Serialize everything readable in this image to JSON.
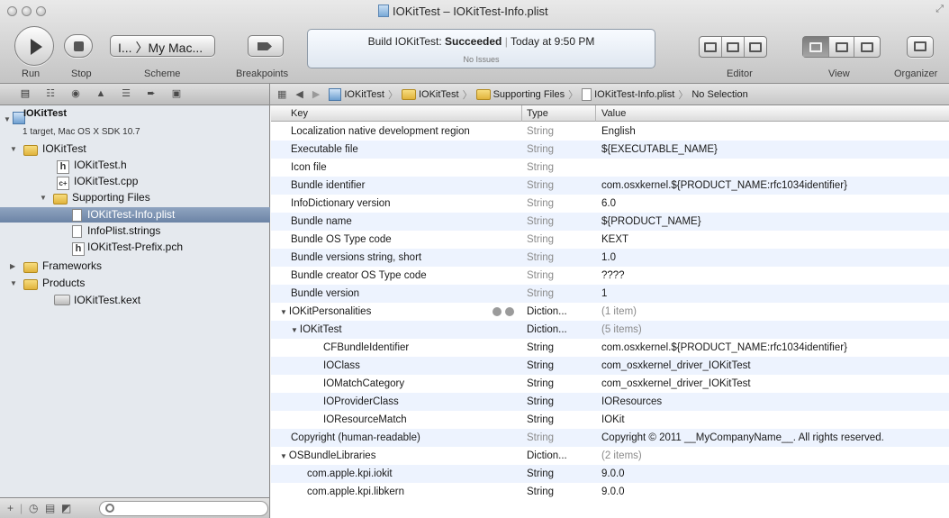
{
  "window": {
    "title": "IOKitTest – IOKitTest-Info.plist"
  },
  "toolbar": {
    "run_label": "Run",
    "stop_label": "Stop",
    "scheme_text": "I... 〉My Mac...",
    "scheme_label": "Scheme",
    "breakpoints_label": "Breakpoints",
    "activity_title": "Build IOKitTest: Succeeded",
    "activity_bold": "Succeeded",
    "activity_prefix": "Build IOKitTest:",
    "activity_time": "Today at 9:50 PM",
    "activity_issues": "No Issues",
    "editor_label": "Editor",
    "view_label": "View",
    "organizer_label": "Organizer"
  },
  "jump_bar": {
    "items": [
      "IOKitTest",
      "IOKitTest",
      "Supporting Files",
      "IOKitTest-Info.plist",
      "No Selection"
    ]
  },
  "sidebar": {
    "project_name": "IOKitTest",
    "project_sub": "1 target, Mac OS X SDK 10.7",
    "items": [
      {
        "label": "IOKitTest",
        "kind": "folder"
      },
      {
        "label": "IOKitTest.h",
        "kind": "h-file"
      },
      {
        "label": "IOKitTest.cpp",
        "kind": "cpp-file"
      },
      {
        "label": "Supporting Files",
        "kind": "folder"
      },
      {
        "label": "IOKitTest-Info.plist",
        "kind": "plist-file"
      },
      {
        "label": "InfoPlist.strings",
        "kind": "strings-file"
      },
      {
        "label": "IOKitTest-Prefix.pch",
        "kind": "h-file"
      },
      {
        "label": "Frameworks",
        "kind": "folder"
      },
      {
        "label": "Products",
        "kind": "folder"
      },
      {
        "label": "IOKitTest.kext",
        "kind": "kext"
      }
    ]
  },
  "plist": {
    "headers": {
      "key": "Key",
      "type": "Type",
      "value": "Value"
    },
    "rows": [
      {
        "key": "Localization native development region",
        "type": "String",
        "value": "English"
      },
      {
        "key": "Executable file",
        "type": "String",
        "value": "${EXECUTABLE_NAME}"
      },
      {
        "key": "Icon file",
        "type": "String",
        "value": ""
      },
      {
        "key": "Bundle identifier",
        "type": "String",
        "value": "com.osxkernel.${PRODUCT_NAME:rfc1034identifier}"
      },
      {
        "key": "InfoDictionary version",
        "type": "String",
        "value": "6.0"
      },
      {
        "key": "Bundle name",
        "type": "String",
        "value": "${PRODUCT_NAME}"
      },
      {
        "key": "Bundle OS Type code",
        "type": "String",
        "value": "KEXT"
      },
      {
        "key": "Bundle versions string, short",
        "type": "String",
        "value": "1.0"
      },
      {
        "key": "Bundle creator OS Type code",
        "type": "String",
        "value": "????"
      },
      {
        "key": "Bundle version",
        "type": "String",
        "value": "1"
      },
      {
        "key": "IOKitPersonalities",
        "type": "Diction...",
        "value": "(1 item)"
      },
      {
        "key": "IOKitTest",
        "type": "Diction...",
        "value": "(5 items)"
      },
      {
        "key": "CFBundleIdentifier",
        "type": "String",
        "value": "com.osxkernel.${PRODUCT_NAME:rfc1034identifier}"
      },
      {
        "key": "IOClass",
        "type": "String",
        "value": "com_osxkernel_driver_IOKitTest"
      },
      {
        "key": "IOMatchCategory",
        "type": "String",
        "value": "com_osxkernel_driver_IOKitTest"
      },
      {
        "key": "IOProviderClass",
        "type": "String",
        "value": "IOResources"
      },
      {
        "key": "IOResourceMatch",
        "type": "String",
        "value": "IOKit"
      },
      {
        "key": "Copyright (human-readable)",
        "type": "String",
        "value": "Copyright © 2011 __MyCompanyName__. All rights reserved."
      },
      {
        "key": "OSBundleLibraries",
        "type": "Diction...",
        "value": "(2 items)"
      },
      {
        "key": "com.apple.kpi.iokit",
        "type": "String",
        "value": "9.0.0"
      },
      {
        "key": "com.apple.kpi.libkern",
        "type": "String",
        "value": "9.0.0"
      }
    ]
  }
}
